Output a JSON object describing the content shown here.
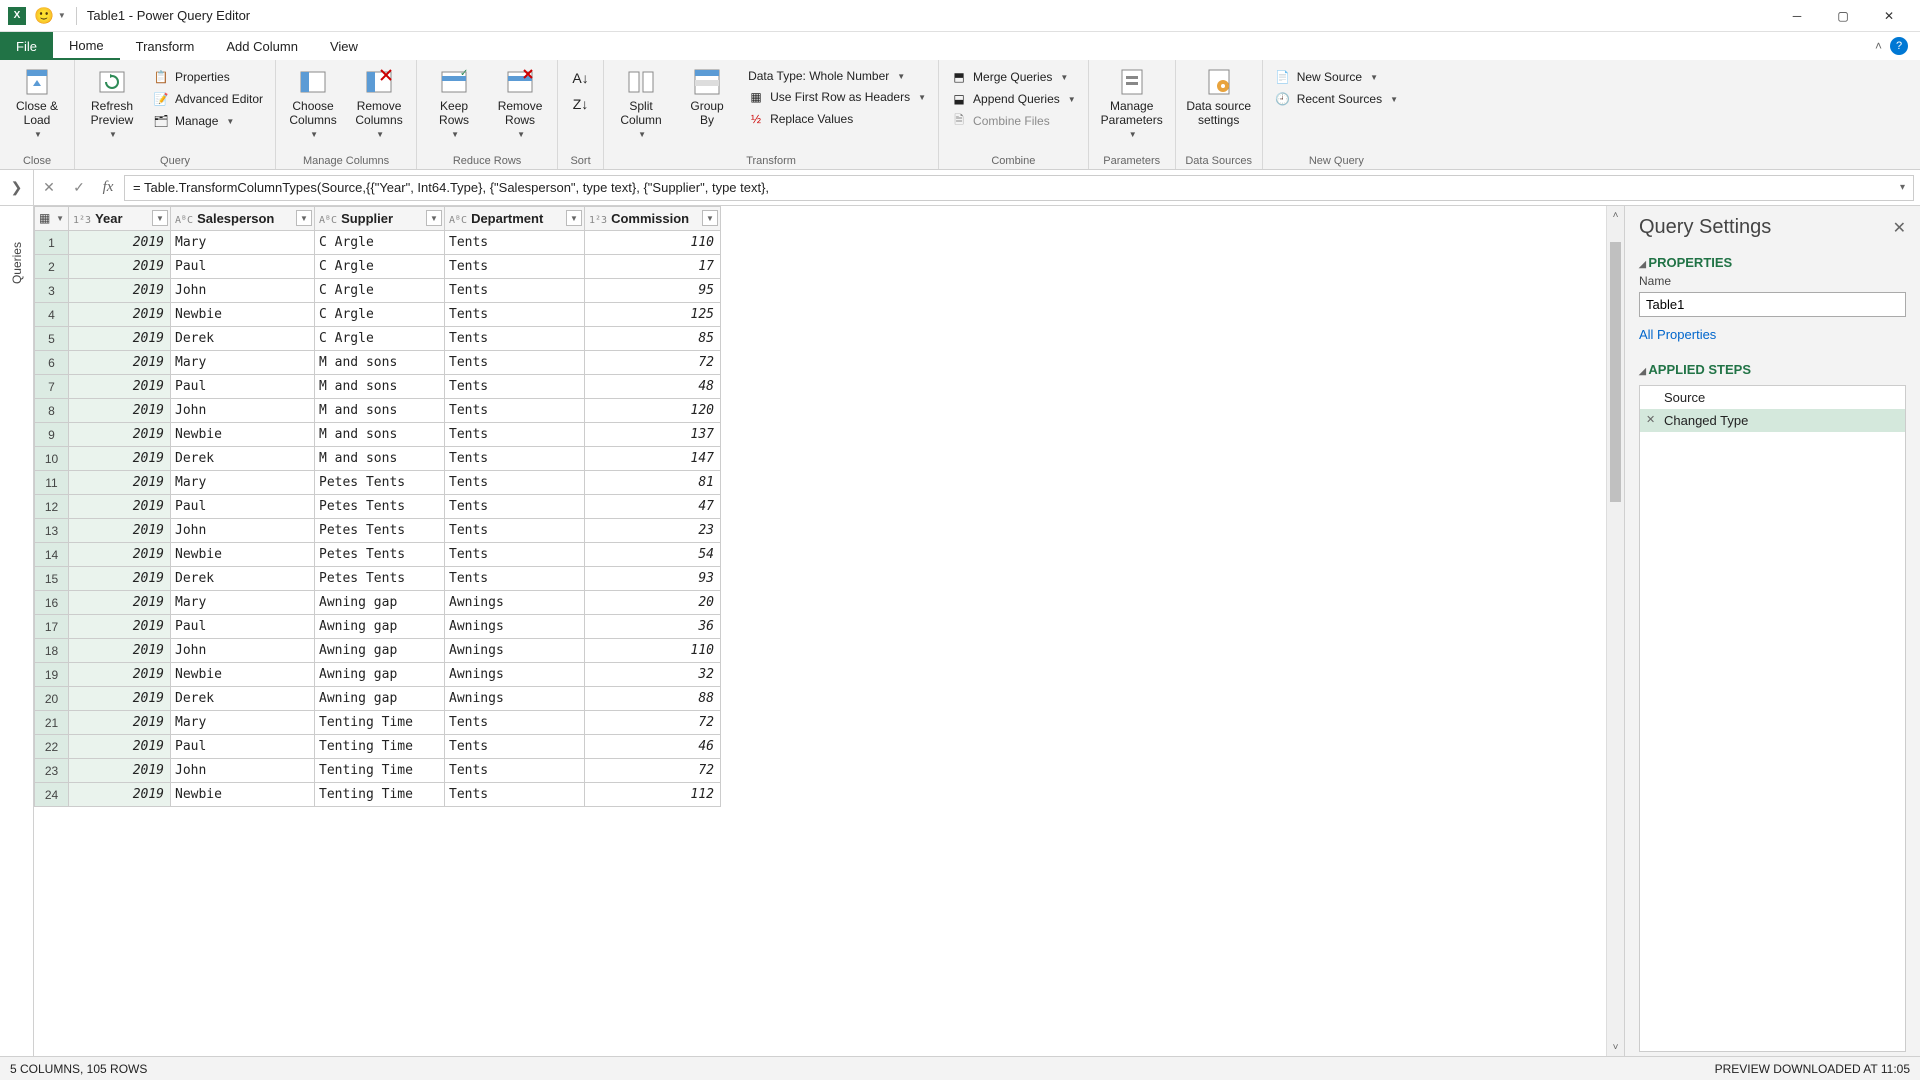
{
  "title": "Table1 - Power Query Editor",
  "tabs": {
    "file": "File",
    "home": "Home",
    "transform": "Transform",
    "addcol": "Add Column",
    "view": "View"
  },
  "ribbon": {
    "close": {
      "close_load": "Close &\nLoad",
      "group": "Close"
    },
    "query": {
      "refresh": "Refresh\nPreview",
      "properties": "Properties",
      "adv_editor": "Advanced Editor",
      "manage": "Manage",
      "group": "Query"
    },
    "managecols": {
      "choose": "Choose\nColumns",
      "remove": "Remove\nColumns",
      "group": "Manage Columns"
    },
    "reducerows": {
      "keep": "Keep\nRows",
      "remove": "Remove\nRows",
      "group": "Reduce Rows"
    },
    "sort": {
      "group": "Sort"
    },
    "transform": {
      "split": "Split\nColumn",
      "groupby": "Group\nBy",
      "datatype": "Data Type: Whole Number",
      "firstrow": "Use First Row as Headers",
      "replace": "Replace Values",
      "group": "Transform"
    },
    "combine": {
      "merge": "Merge Queries",
      "append": "Append Queries",
      "files": "Combine Files",
      "group": "Combine"
    },
    "params": {
      "manage": "Manage\nParameters",
      "group": "Parameters"
    },
    "ds": {
      "settings": "Data source\nsettings",
      "group": "Data Sources"
    },
    "newq": {
      "newsrc": "New Source",
      "recent": "Recent Sources",
      "group": "New Query"
    }
  },
  "formula": "= Table.TransformColumnTypes(Source,{{\"Year\", Int64.Type}, {\"Salesperson\", type text}, {\"Supplier\", type text},",
  "queries_label": "Queries",
  "columns": {
    "year": "Year",
    "salesperson": "Salesperson",
    "supplier": "Supplier",
    "department": "Department",
    "commission": "Commission"
  },
  "rows": [
    {
      "n": 1,
      "year": 2019,
      "sales": "Mary",
      "supp": "C Argle",
      "dept": "Tents",
      "comm": 110
    },
    {
      "n": 2,
      "year": 2019,
      "sales": "Paul",
      "supp": "C Argle",
      "dept": "Tents",
      "comm": 17
    },
    {
      "n": 3,
      "year": 2019,
      "sales": "John",
      "supp": "C Argle",
      "dept": "Tents",
      "comm": 95
    },
    {
      "n": 4,
      "year": 2019,
      "sales": "Newbie",
      "supp": "C Argle",
      "dept": "Tents",
      "comm": 125
    },
    {
      "n": 5,
      "year": 2019,
      "sales": "Derek",
      "supp": "C Argle",
      "dept": "Tents",
      "comm": 85
    },
    {
      "n": 6,
      "year": 2019,
      "sales": "Mary",
      "supp": "M and sons",
      "dept": "Tents",
      "comm": 72
    },
    {
      "n": 7,
      "year": 2019,
      "sales": "Paul",
      "supp": "M and sons",
      "dept": "Tents",
      "comm": 48
    },
    {
      "n": 8,
      "year": 2019,
      "sales": "John",
      "supp": "M and sons",
      "dept": "Tents",
      "comm": 120
    },
    {
      "n": 9,
      "year": 2019,
      "sales": "Newbie",
      "supp": "M and sons",
      "dept": "Tents",
      "comm": 137
    },
    {
      "n": 10,
      "year": 2019,
      "sales": "Derek",
      "supp": "M and sons",
      "dept": "Tents",
      "comm": 147
    },
    {
      "n": 11,
      "year": 2019,
      "sales": "Mary",
      "supp": "Petes Tents",
      "dept": "Tents",
      "comm": 81
    },
    {
      "n": 12,
      "year": 2019,
      "sales": "Paul",
      "supp": "Petes Tents",
      "dept": "Tents",
      "comm": 47
    },
    {
      "n": 13,
      "year": 2019,
      "sales": "John",
      "supp": "Petes Tents",
      "dept": "Tents",
      "comm": 23
    },
    {
      "n": 14,
      "year": 2019,
      "sales": "Newbie",
      "supp": "Petes Tents",
      "dept": "Tents",
      "comm": 54
    },
    {
      "n": 15,
      "year": 2019,
      "sales": "Derek",
      "supp": "Petes Tents",
      "dept": "Tents",
      "comm": 93
    },
    {
      "n": 16,
      "year": 2019,
      "sales": "Mary",
      "supp": "Awning gap",
      "dept": "Awnings",
      "comm": 20
    },
    {
      "n": 17,
      "year": 2019,
      "sales": "Paul",
      "supp": "Awning gap",
      "dept": "Awnings",
      "comm": 36
    },
    {
      "n": 18,
      "year": 2019,
      "sales": "John",
      "supp": "Awning gap",
      "dept": "Awnings",
      "comm": 110
    },
    {
      "n": 19,
      "year": 2019,
      "sales": "Newbie",
      "supp": "Awning gap",
      "dept": "Awnings",
      "comm": 32
    },
    {
      "n": 20,
      "year": 2019,
      "sales": "Derek",
      "supp": "Awning gap",
      "dept": "Awnings",
      "comm": 88
    },
    {
      "n": 21,
      "year": 2019,
      "sales": "Mary",
      "supp": "Tenting Time",
      "dept": "Tents",
      "comm": 72
    },
    {
      "n": 22,
      "year": 2019,
      "sales": "Paul",
      "supp": "Tenting Time",
      "dept": "Tents",
      "comm": 46
    },
    {
      "n": 23,
      "year": 2019,
      "sales": "John",
      "supp": "Tenting Time",
      "dept": "Tents",
      "comm": 72
    },
    {
      "n": 24,
      "year": 2019,
      "sales": "Newbie",
      "supp": "Tenting Time",
      "dept": "Tents",
      "comm": 112
    }
  ],
  "settings": {
    "title": "Query Settings",
    "properties": "PROPERTIES",
    "name_label": "Name",
    "name_value": "Table1",
    "all_props": "All Properties",
    "applied": "APPLIED STEPS",
    "steps": {
      "source": "Source",
      "changed": "Changed Type"
    }
  },
  "status": {
    "left": "5 COLUMNS, 105 ROWS",
    "right": "PREVIEW DOWNLOADED AT 11:05"
  }
}
